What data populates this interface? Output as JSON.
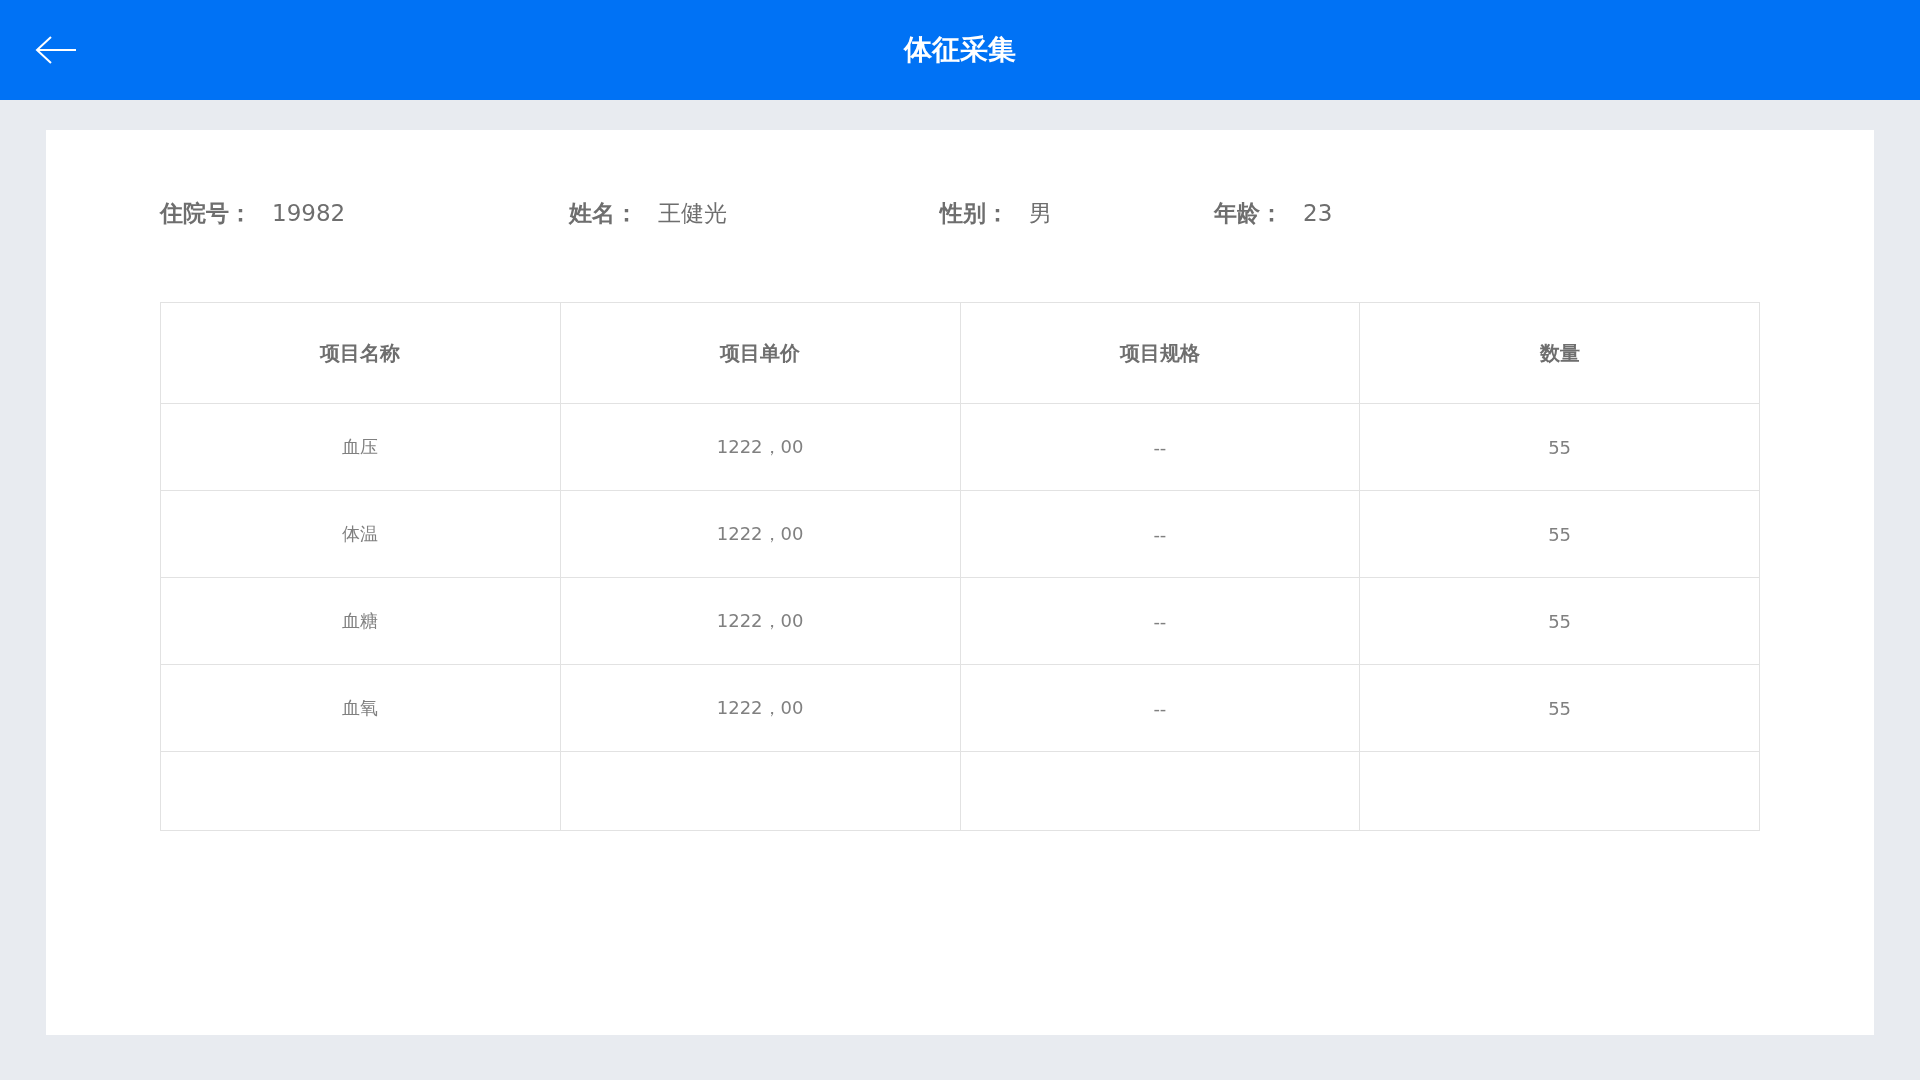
{
  "header": {
    "title": "体征采集"
  },
  "patient": [
    {
      "label": "住院号：",
      "value": "19982"
    },
    {
      "label": "姓名：",
      "value": "王健光"
    },
    {
      "label": "性别：",
      "value": "男"
    },
    {
      "label": "年龄：",
      "value": "23"
    }
  ],
  "table": {
    "columns": [
      "项目名称",
      "项目单价",
      "项目规格",
      "数量"
    ],
    "rows": [
      [
        "血压",
        "1222，00",
        "--",
        "55"
      ],
      [
        "体温",
        "1222，00",
        "--",
        "55"
      ],
      [
        "血糖",
        "1222，00",
        "--",
        "55"
      ],
      [
        "血氧",
        "1222，00",
        "--",
        "55"
      ]
    ]
  }
}
